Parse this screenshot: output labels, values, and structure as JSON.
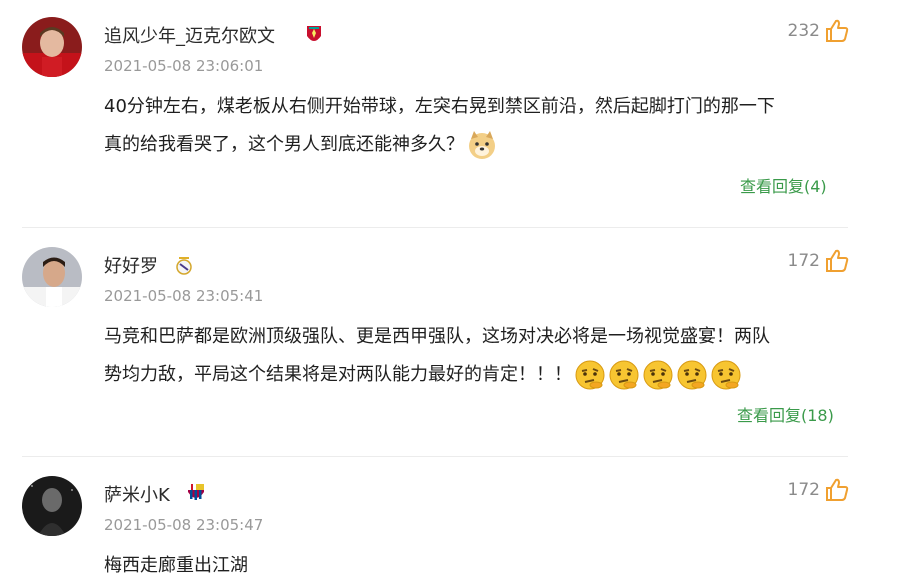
{
  "comments": [
    {
      "username": "追风少年_迈克尔欧文",
      "time": "2021-05-08 23:06:01",
      "likes": "232",
      "text_line1": "40分钟左右，煤老板从右侧开始带球，左突右晃到禁区前沿，然后起脚打门的那一下",
      "text_line2": "真的给我看哭了，这个男人到底还能神多久？",
      "reply": "查看回复(4)",
      "badge_icon": "liverpool-crest-icon",
      "emoji_icon": "doge-emoji-icon"
    },
    {
      "username": "好好罗",
      "time": "2021-05-08 23:05:41",
      "likes": "172",
      "text_line1": "马竞和巴萨都是欧洲顶级强队、更是西甲强队，这场对决必将是一场视觉盛宴！两队",
      "text_line2": "势均力敌，平局这个结果将是对两队能力最好的肯定！！！",
      "reply": "查看回复(18)",
      "badge_icon": "real-madrid-crest-icon",
      "emoji_icon": "thinking-emoji-icon"
    },
    {
      "username": "萨米小K",
      "time": "2021-05-08 23:05:47",
      "likes": "172",
      "text_line1": "梅西走廊重出江湖",
      "badge_icon": "barcelona-crest-icon"
    }
  ],
  "colors": {
    "reply_green": "#3a9a4a",
    "like_orange": "#f0a030",
    "time_gray": "#999999"
  }
}
